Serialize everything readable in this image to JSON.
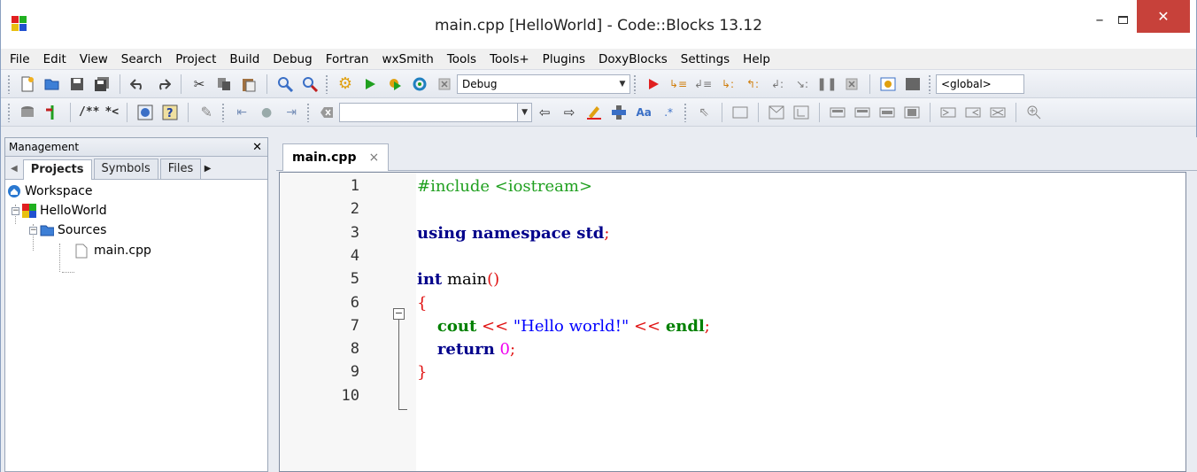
{
  "window": {
    "title": "main.cpp [HelloWorld] - Code::Blocks 13.12",
    "minimize_glyph": "–",
    "close_glyph": "✕"
  },
  "menu": [
    "File",
    "Edit",
    "View",
    "Search",
    "Project",
    "Build",
    "Debug",
    "Fortran",
    "wxSmith",
    "Tools",
    "Tools+",
    "Plugins",
    "DoxyBlocks",
    "Settings",
    "Help"
  ],
  "toolbar1": {
    "build_target": "Debug",
    "scope": "<global>"
  },
  "toolbar2": {
    "comment_label": "/**",
    "comment_label2": "*<",
    "regex_label": ".*",
    "search_value": ""
  },
  "management": {
    "title": "Management",
    "close_glyph": "✕",
    "tabs": [
      "Projects",
      "Symbols",
      "Files"
    ],
    "tree": {
      "workspace": "Workspace",
      "project": "HelloWorld",
      "folder": "Sources",
      "file": "main.cpp"
    }
  },
  "editor": {
    "tab_label": "main.cpp",
    "tab_close": "×",
    "line_numbers": [
      "1",
      "2",
      "3",
      "4",
      "5",
      "6",
      "7",
      "8",
      "9",
      "10"
    ],
    "lines": [
      {
        "parts": [
          {
            "t": "#include <iostream>",
            "c": "pp"
          }
        ]
      },
      {
        "parts": []
      },
      {
        "parts": [
          {
            "t": "using namespace std",
            "c": "kw"
          },
          {
            "t": ";",
            "c": "op"
          }
        ]
      },
      {
        "parts": []
      },
      {
        "parts": [
          {
            "t": "int",
            "c": "kw"
          },
          {
            "t": " main",
            "c": ""
          },
          {
            "t": "()",
            "c": "op"
          }
        ]
      },
      {
        "parts": [
          {
            "t": "{",
            "c": "op"
          }
        ]
      },
      {
        "parts": [
          {
            "t": "    ",
            "c": ""
          },
          {
            "t": "cout",
            "c": "kw2"
          },
          {
            "t": " << ",
            "c": "op"
          },
          {
            "t": "\"Hello world!\"",
            "c": "str"
          },
          {
            "t": " << ",
            "c": "op"
          },
          {
            "t": "endl",
            "c": "kw2"
          },
          {
            "t": ";",
            "c": "op"
          }
        ]
      },
      {
        "parts": [
          {
            "t": "    ",
            "c": ""
          },
          {
            "t": "return",
            "c": "kw"
          },
          {
            "t": " ",
            "c": ""
          },
          {
            "t": "0",
            "c": "num"
          },
          {
            "t": ";",
            "c": "op"
          }
        ]
      },
      {
        "parts": [
          {
            "t": "}",
            "c": "op"
          }
        ]
      },
      {
        "parts": []
      }
    ]
  },
  "colors": {
    "preprocessor": "#20a020",
    "keyword": "#00008b",
    "std_identifier": "#008000",
    "operator": "#e01010",
    "string": "#0000ff",
    "number": "#f000f0",
    "close_button": "#c7413a"
  }
}
